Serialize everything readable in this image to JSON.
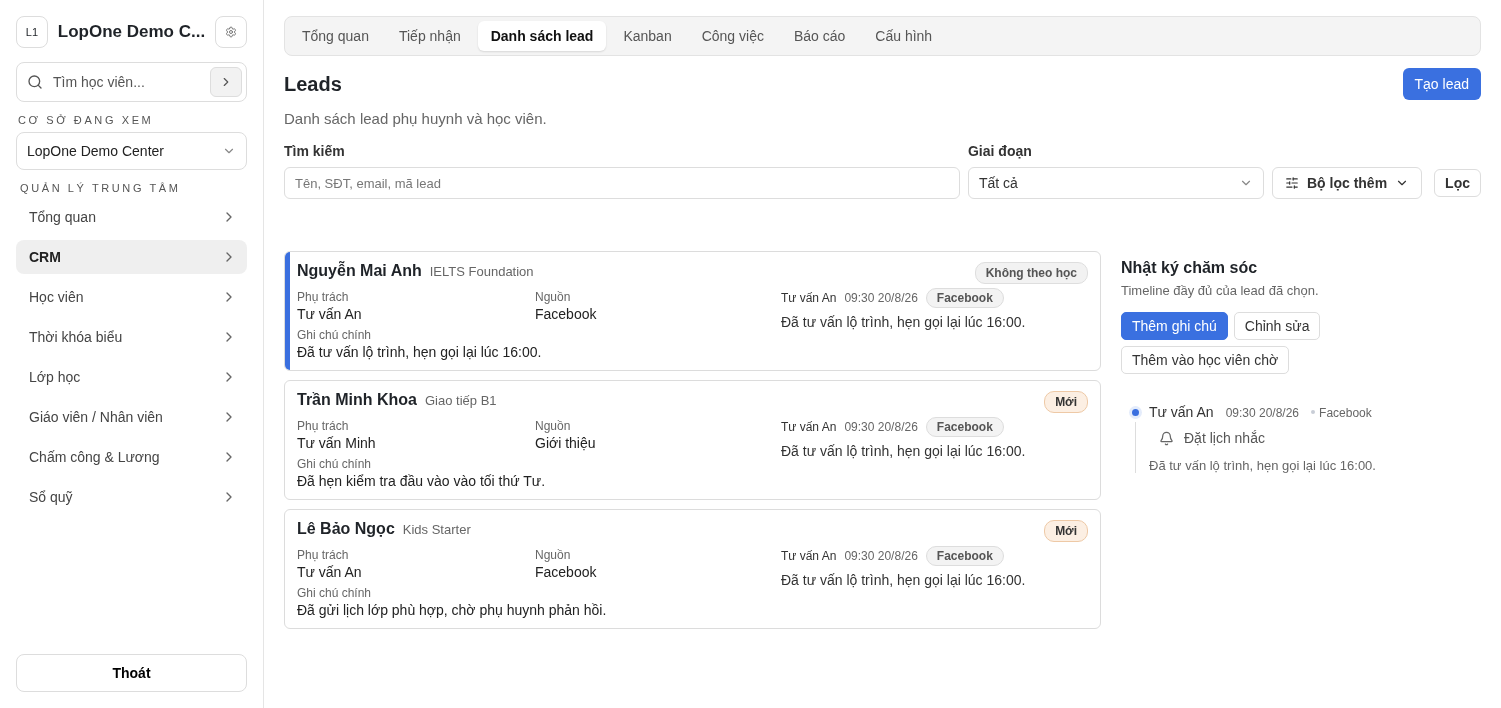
{
  "sidebar": {
    "logo": "L1",
    "title": "LopOne Demo C...",
    "search": {
      "placeholder": "Tìm học viên..."
    },
    "branch_label": "CƠ SỞ ĐANG XEM",
    "branch": "LopOne Demo Center",
    "section_label": "QUẢN LÝ TRUNG TÂM",
    "items": [
      {
        "label": "Tổng quan",
        "selected": false
      },
      {
        "label": "CRM",
        "selected": true
      },
      {
        "label": "Học viên",
        "selected": false
      },
      {
        "label": "Thời khóa biểu",
        "selected": false
      },
      {
        "label": "Lớp học",
        "selected": false
      },
      {
        "label": "Giáo viên / Nhân viên",
        "selected": false
      },
      {
        "label": "Chấm công & Lương",
        "selected": false
      },
      {
        "label": "Sổ quỹ",
        "selected": false
      }
    ],
    "logout": "Thoát"
  },
  "tabs": [
    {
      "label": "Tổng quan",
      "selected": false
    },
    {
      "label": "Tiếp nhận",
      "selected": false
    },
    {
      "label": "Danh sách lead",
      "selected": true
    },
    {
      "label": "Kanban",
      "selected": false
    },
    {
      "label": "Công việc",
      "selected": false
    },
    {
      "label": "Báo cáo",
      "selected": false
    },
    {
      "label": "Cấu hình",
      "selected": false
    }
  ],
  "header": {
    "title": "Leads",
    "subtitle": "Danh sách lead phụ huynh và học viên.",
    "create_button": "Tạo lead"
  },
  "filters": {
    "search_label": "Tìm kiếm",
    "search_placeholder": "Tên, SĐT, email, mã lead",
    "stage_label": "Giai đoạn",
    "stage_value": "Tất cả",
    "more_filters": "Bộ lọc thêm",
    "apply": "Lọc"
  },
  "leads": [
    {
      "name": "Nguyễn Mai Anh",
      "course": "IELTS Foundation",
      "status": "Không theo học",
      "kind": "inactive",
      "selected": true,
      "owner_label": "Phụ trách",
      "owner": "Tư vấn An",
      "source_label": "Nguồn",
      "source": "Facebook",
      "note_label": "Ghi chú chính",
      "note": "Đã tư vấn lộ trình, hẹn gọi lại lúc 16:00.",
      "log_author": "Tư vấn An",
      "log_time": "09:30 20/8/26",
      "log_tag": "Facebook",
      "log_text": "Đã tư vấn lộ trình, hẹn gọi lại lúc 16:00."
    },
    {
      "name": "Trần Minh Khoa",
      "course": "Giao tiếp B1",
      "status": "Mới",
      "kind": "new",
      "selected": false,
      "owner_label": "Phụ trách",
      "owner": "Tư vấn Minh",
      "source_label": "Nguồn",
      "source": "Giới thiệu",
      "note_label": "Ghi chú chính",
      "note": "Đã hẹn kiểm tra đầu vào vào tối thứ Tư.",
      "log_author": "Tư vấn An",
      "log_time": "09:30 20/8/26",
      "log_tag": "Facebook",
      "log_text": "Đã tư vấn lộ trình, hẹn gọi lại lúc 16:00."
    },
    {
      "name": "Lê Bảo Ngọc",
      "course": "Kids Starter",
      "status": "Mới",
      "kind": "new",
      "selected": false,
      "owner_label": "Phụ trách",
      "owner": "Tư vấn An",
      "source_label": "Nguồn",
      "source": "Facebook",
      "note_label": "Ghi chú chính",
      "note": "Đã gửi lịch lớp phù hợp, chờ phụ huynh phản hồi.",
      "log_author": "Tư vấn An",
      "log_time": "09:30 20/8/26",
      "log_tag": "Facebook",
      "log_text": "Đã tư vấn lộ trình, hẹn gọi lại lúc 16:00."
    }
  ],
  "care_log": {
    "title": "Nhật ký chăm sóc",
    "subtitle": "Timeline đầy đủ của lead đã chọn.",
    "actions": [
      {
        "label": "Thêm ghi chú",
        "primary": true
      },
      {
        "label": "Chỉnh sửa",
        "primary": false
      },
      {
        "label": "Thêm vào học viên chờ",
        "primary": false
      }
    ],
    "entries": [
      {
        "author": "Tư vấn An",
        "time": "09:30 20/8/26",
        "source": "Facebook",
        "reminder": "Đặt lịch nhắc",
        "text": "Đã tư vấn lộ trình, hẹn gọi lại lúc 16:00."
      }
    ]
  }
}
